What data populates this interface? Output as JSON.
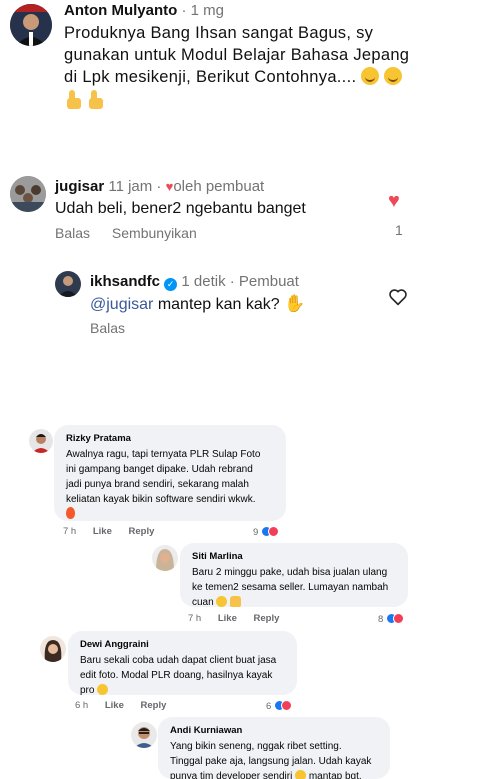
{
  "top_comment": {
    "author": "Anton Mulyanto",
    "time": " · 1 mg",
    "line1": "Produknya Bang Ihsan sangat Bagus, sy",
    "line2": "gunakan untuk Modul Belajar Bahasa Jepang",
    "line3": "di Lpk mesikenji, Berikut Contohnya.... "
  },
  "ig_comment": {
    "author": "jugisar",
    "time": " 11 jam · ",
    "liked_by": "oleh pembuat",
    "text": "Udah beli, bener2 ngebantu banget",
    "reply": "Balas",
    "hide": "Sembunyikan",
    "like_count": "1"
  },
  "ig_reply": {
    "author": "ikhsandfc",
    "time": " 1 detik · Pembuat",
    "mention": "@jugisar",
    "text": " mantep kan kak? ",
    "reply": "Balas"
  },
  "fb_comments": [
    {
      "author": "Rizky Pratama",
      "lines": [
        "Awalnya ragu, tapi ternyata PLR Sulap Foto",
        "ini gampang banget dipake. Udah rebrand",
        "jadi punya brand sendiri, sekarang malah",
        "keliatan kayak bikin software sendiri wkwk."
      ],
      "time": "7 h",
      "like": "Like",
      "reply": "Reply",
      "reactions": "9"
    },
    {
      "author": "Siti Marlina",
      "lines": [
        "Baru 2 minggu pake, udah bisa jualan ulang",
        "ke temen2 sesama seller. Lumayan nambah",
        "cuan "
      ],
      "time": "7 h",
      "like": "Like",
      "reply": "Reply",
      "reactions": "8"
    },
    {
      "author": "Dewi Anggraini",
      "lines": [
        "Baru sekali coba udah dapat client buat jasa",
        "edit foto. Modal PLR doang, hasilnya kayak",
        "pro "
      ],
      "time": "6 h",
      "like": "Like",
      "reply": "Reply",
      "reactions": "6"
    },
    {
      "author": "Andi Kurniawan",
      "lines": [
        "Yang bikin seneng, nggak ribet setting.",
        "Tinggal pake aja, langsung jalan. Udah kayak",
        "punya tim developer sendiri ",
        " mantap bgt."
      ]
    }
  ]
}
